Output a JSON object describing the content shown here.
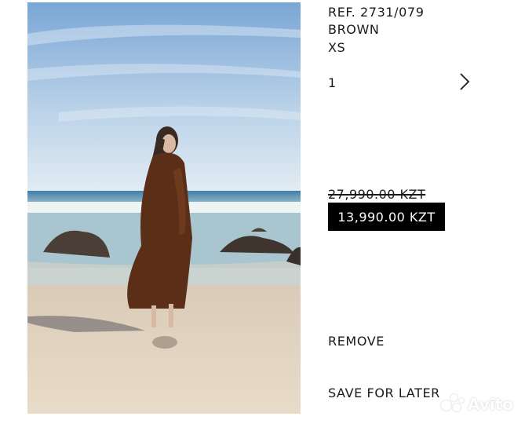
{
  "product": {
    "ref": "REF. 2731/079",
    "color": "BROWN",
    "size": "XS",
    "quantity": "1",
    "original_price": "27,990.00 KZT",
    "sale_price": "13,990.00 KZT"
  },
  "actions": {
    "remove_label": "REMOVE",
    "save_label": "SAVE FOR LATER"
  },
  "icons": {
    "quantity_next": "chevron-right-icon"
  },
  "watermark": {
    "text": "Avito"
  },
  "colors": {
    "price_badge_bg": "#000000",
    "price_badge_text": "#ffffff"
  }
}
